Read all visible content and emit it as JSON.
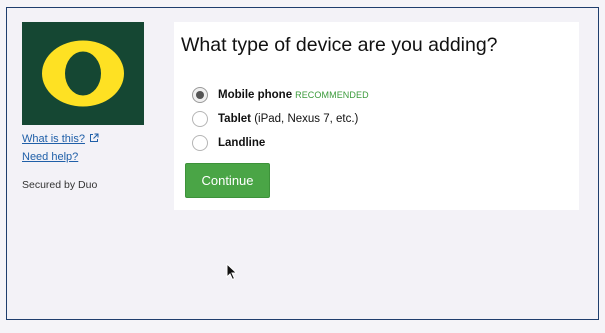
{
  "sidebar": {
    "logo_letter": "O",
    "help_links": [
      {
        "label": "What is this?"
      },
      {
        "label": "Need help?"
      }
    ],
    "secured_text": "Secured by Duo"
  },
  "main": {
    "title": "What type of device are you adding?",
    "options": [
      {
        "label": "Mobile phone",
        "suffix": "",
        "badge": "RECOMMENDED",
        "selected": true
      },
      {
        "label": "Tablet",
        "suffix": " (iPad, Nexus 7, etc.)",
        "badge": "",
        "selected": false
      },
      {
        "label": "Landline",
        "suffix": "",
        "badge": "",
        "selected": false
      }
    ],
    "continue_label": "Continue"
  },
  "colors": {
    "logo_bg": "#154733",
    "logo_letter": "#FEE123",
    "primary_button": "#4aa546",
    "link": "#1f5fa8",
    "recommended": "#3a9a3a"
  },
  "icons": [
    "external-link-icon",
    "mouse-cursor-icon"
  ]
}
